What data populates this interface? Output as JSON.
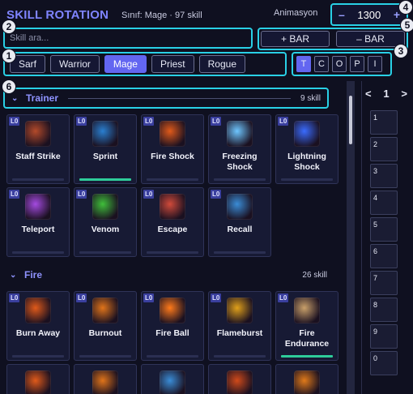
{
  "header": {
    "title": "SKILL ROTATION",
    "subtitle": "Sınıf: Mage · 97 skill",
    "animation_label": "Animasyon",
    "animation_value": "1300",
    "minus": "–",
    "plus": "+"
  },
  "search": {
    "placeholder": "Skill ara..."
  },
  "bar": {
    "add_label": "+ BAR",
    "remove_label": "– BAR"
  },
  "classes": [
    "Sarf",
    "Warrior",
    "Mage",
    "Priest",
    "Rogue"
  ],
  "active_class": "Mage",
  "filters": [
    "T",
    "C",
    "O",
    "P",
    "I"
  ],
  "active_filter": "T",
  "badges": [
    "1",
    "2",
    "3",
    "4",
    "5",
    "6"
  ],
  "sections": [
    {
      "title": "Trainer",
      "count": "9 skill",
      "skills": [
        {
          "level": "L0",
          "name": "Staff Strike",
          "icon": "staff-strike-icon",
          "color": "#b34a2a"
        },
        {
          "level": "L0",
          "name": "Sprint",
          "icon": "sprint-icon",
          "color": "#2a7fd0",
          "active": true
        },
        {
          "level": "L0",
          "name": "Fire Shock",
          "icon": "fire-shock-icon",
          "color": "#e05a1a"
        },
        {
          "level": "L0",
          "name": "Freezing Shock",
          "icon": "freezing-shock-icon",
          "color": "#6ec6ff"
        },
        {
          "level": "L0",
          "name": "Lightning Shock",
          "icon": "lightning-shock-icon",
          "color": "#3a6cff"
        },
        {
          "level": "L0",
          "name": "Teleport",
          "icon": "teleport-icon",
          "color": "#a44ae0"
        },
        {
          "level": "L0",
          "name": "Venom",
          "icon": "venom-icon",
          "color": "#3fbf3a"
        },
        {
          "level": "L0",
          "name": "Escape",
          "icon": "escape-icon",
          "color": "#d04a3a"
        },
        {
          "level": "L0",
          "name": "Recall",
          "icon": "recall-icon",
          "color": "#3a8cd6"
        }
      ]
    },
    {
      "title": "Fire",
      "count": "26 skill",
      "skills": [
        {
          "level": "L0",
          "name": "Burn Away",
          "icon": "burn-away-icon",
          "color": "#e05a1a"
        },
        {
          "level": "L0",
          "name": "Burnout",
          "icon": "burnout-icon",
          "color": "#e0741a"
        },
        {
          "level": "L0",
          "name": "Fire Ball",
          "icon": "fire-ball-icon",
          "color": "#ff7a1a"
        },
        {
          "level": "L0",
          "name": "Flameburst",
          "icon": "flameburst-icon",
          "color": "#e0a01a"
        },
        {
          "level": "L0",
          "name": "Fire Endurance",
          "icon": "fire-endurance-icon",
          "color": "#c9a06a",
          "active": true
        }
      ]
    }
  ],
  "next_row_icons": [
    {
      "icon": "fire-skill-icon",
      "color": "#e05a1a"
    },
    {
      "icon": "fire-skill-icon",
      "color": "#e0741a"
    },
    {
      "icon": "fire-skill-icon",
      "color": "#3a8cd6"
    },
    {
      "icon": "fire-skill-icon",
      "color": "#d04a1a"
    },
    {
      "icon": "fire-skill-icon",
      "color": "#e07a1a"
    }
  ],
  "pager": {
    "prev": "<",
    "page": "1",
    "next": ">",
    "slots": [
      "1",
      "2",
      "3",
      "4",
      "5",
      "6",
      "7",
      "8",
      "9",
      "0"
    ]
  }
}
